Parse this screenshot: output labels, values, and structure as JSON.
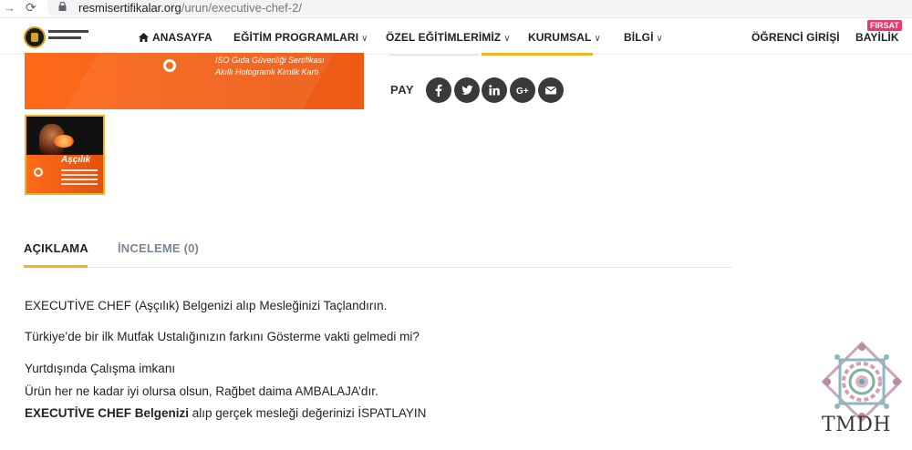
{
  "browser": {
    "url_host": "resmisertifikalar.org",
    "url_path": "/urun/executive-chef-2/"
  },
  "nav": {
    "home": "ANASAYFA",
    "training": "EĞİTİM PROGRAMLARI",
    "special": "ÖZEL EĞİTİMLERİMİZ",
    "corporate": "KURUMSAL",
    "info": "BİLGİ",
    "student_login": "ÖĞRENCİ GİRİŞİ",
    "dealer": "BAYİLİK",
    "dealer_badge": "FIRSAT"
  },
  "product_image": {
    "line1": "ISO Gıda Güvenliği Sertifikası",
    "line2": "Akıllı Hologramlı Kimlik Kartı"
  },
  "thumbnail": {
    "title": "Aşçılık"
  },
  "share": {
    "label": "PAY",
    "icons": [
      "facebook-icon",
      "twitter-icon",
      "linkedin-icon",
      "google-plus-icon",
      "email-icon"
    ]
  },
  "tabs": {
    "description": "AÇIKLAMA",
    "reviews": "İNCELEME (0)"
  },
  "description": {
    "p1": "EXECUTİVE CHEF (Aşçılık) Belgenizi alıp Mesleğinizi Taçlandırın.",
    "p2": "Türkiye’de bir ilk Mutfak Ustalığınızın farkını Gösterme vakti gelmedi mi?",
    "p3": "Yurtdışında Çalışma imkanı",
    "p4": "Ürün her ne kadar iyi olursa olsun, Rağbet daima AMBALAJA’dır.",
    "p5_bold": "EXECUTİVE CHEF Belgenizi",
    "p5_rest": " alıp gerçek mesleği değerinizi İSPATLAYIN"
  },
  "watermark": {
    "text": "TMDH"
  },
  "colors": {
    "accent": "#f0b323",
    "banner_orange": "#f26119",
    "share_bg": "#3a3a3a",
    "badge": "#e8386d",
    "inactive_tab": "#7a8594"
  }
}
